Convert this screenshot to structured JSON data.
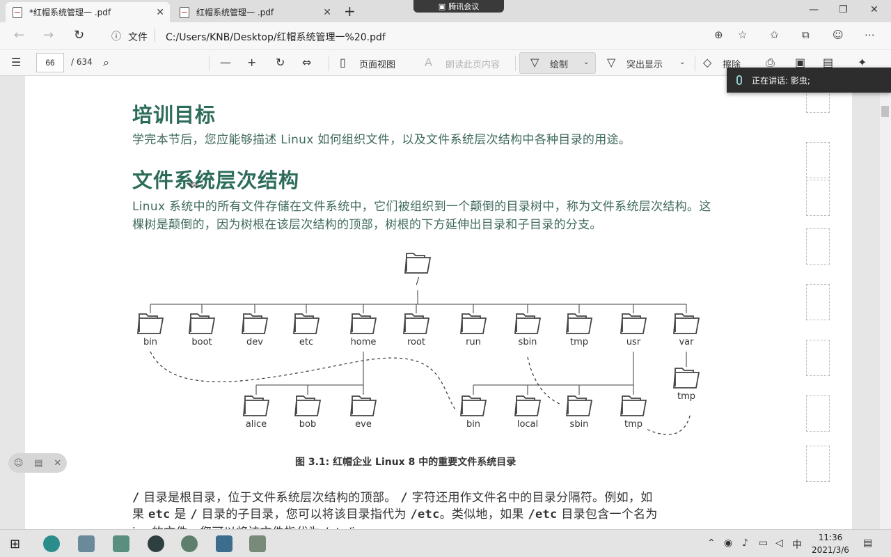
{
  "tabs": [
    {
      "title": "*红帽系统管理一 .pdf",
      "active": true
    },
    {
      "title": "红帽系统管理一 .pdf",
      "active": false
    }
  ],
  "meeting": {
    "app_label": "腾讯会议",
    "speaking_text": "正在讲话: 影虫;"
  },
  "address": {
    "info_label": "文件",
    "path": "C:/Users/KNB/Desktop/红帽系统管理一%20.pdf"
  },
  "toolbar": {
    "page_current": "66",
    "page_total": "/ 634",
    "page_view": "页面视图",
    "read_aloud": "朗读此页内容",
    "draw": "绘制",
    "highlight": "突出显示",
    "erase": "擦除"
  },
  "document": {
    "heading_goal": "培训目标",
    "goal_text": "学完本节后，您应能够描述 Linux 如何组织文件，以及文件系统层次结构中各种目录的用途。",
    "heading_hierarchy": "文件系统层次结构",
    "hierarchy_text": "Linux 系统中的所有文件存储在文件系统中，它们被组织到一个颠倒的目录树中，称为文件系统层次结构。这棵树是颠倒的，因为树根在该层次结构的顶部，树根的下方延伸出目录和子目录的分支。",
    "figure_caption": "图 3.1: 红帽企业 Linux 8 中的重要文件系统目录",
    "para_1": "目录是根目录，位于文件系统层次结构的顶部。",
    "para_2": "字符还用作文件名中的目录分隔符。例如，如",
    "para_3": "果",
    "para_4": "是",
    "para_5": "目录的子目录，您可以将该目录指代为",
    "para_6": "。类似地，如果",
    "para_7": "目录包含一个名为",
    "code_slash": "/",
    "code_etc": "etc",
    "code_etc_path": "/etc",
    "partial_line": "i... 的文件，您可以将该文件指代为 /etc/i..."
  },
  "tree": {
    "root": "/",
    "top_dirs": [
      "bin",
      "boot",
      "dev",
      "etc",
      "home",
      "root",
      "run",
      "sbin",
      "tmp",
      "usr",
      "var"
    ],
    "home_dirs": [
      "alice",
      "bob",
      "eve"
    ],
    "usr_dirs": [
      "bin",
      "local",
      "sbin",
      "tmp"
    ],
    "var_dirs": [
      "tmp"
    ]
  },
  "taskbar": {
    "time": "11:36",
    "date": "2021/3/6",
    "ime": "中"
  }
}
